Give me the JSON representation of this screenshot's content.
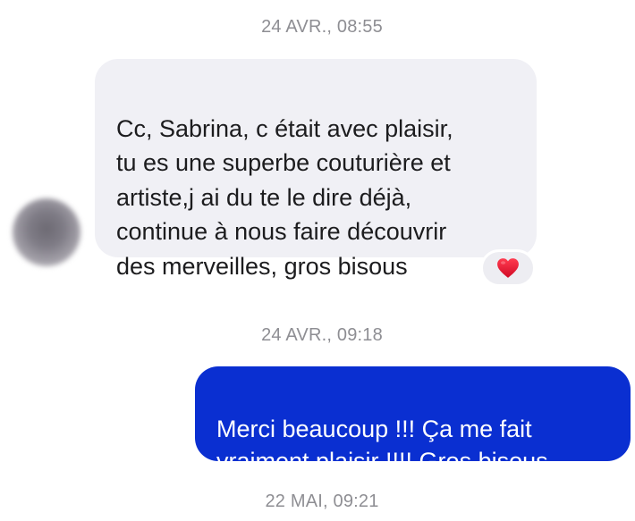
{
  "conversation": {
    "timestamps": [
      "24 AVR., 08:55",
      "24 AVR., 09:18",
      "22 MAI, 09:21"
    ],
    "received_message": {
      "text": "Cc, Sabrina, c était avec plaisir,\ntu es une superbe couturière et\nartiste,j ai du te le dire déjà,\ncontinue à  nous faire découvrir\ndes merveilles, gros bisous",
      "reaction": "heart-icon"
    },
    "sent_message": {
      "text": "Merci beaucoup !!! Ça me fait\nvraiment plaisir !!!! Gros bisous"
    }
  },
  "colors": {
    "sent_bubble": "#0a2fd1",
    "received_bubble": "#f0f0f5",
    "timestamp": "#8e8e93",
    "heart": "#e8112d"
  }
}
